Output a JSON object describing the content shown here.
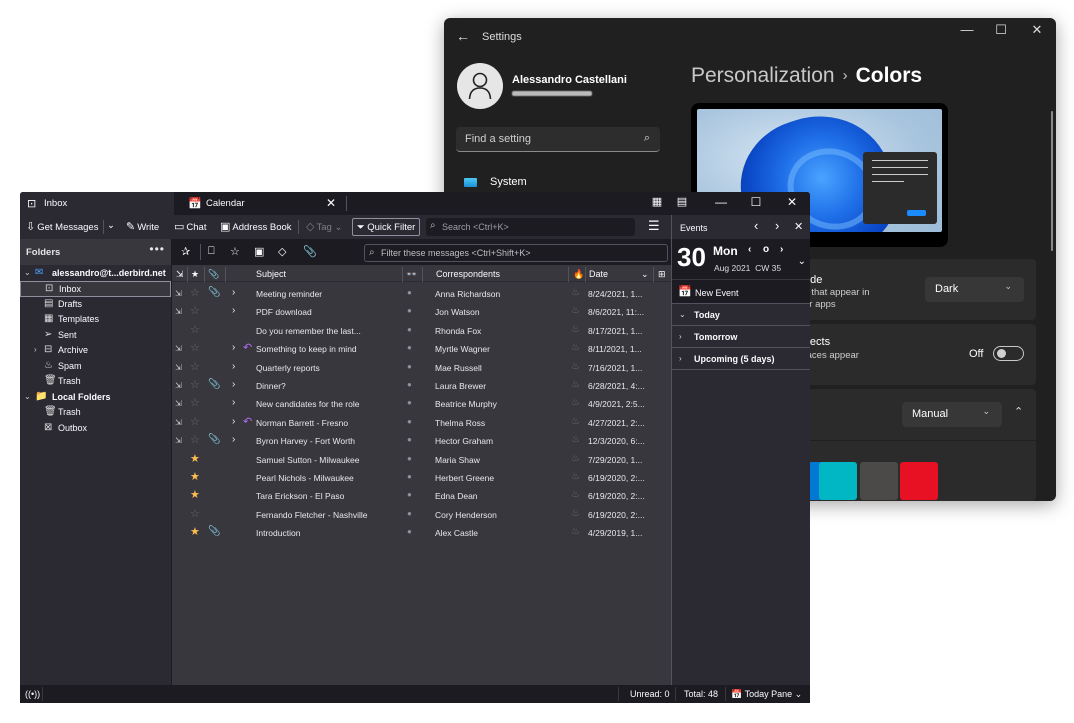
{
  "settings": {
    "title": "Settings",
    "back_icon": "back-arrow-icon",
    "window_controls": {
      "minimize": "—",
      "maximize": "☐",
      "close": "✕"
    },
    "user": {
      "name": "Alessandro Castellani"
    },
    "search": {
      "placeholder": "Find a setting",
      "icon": "⌕"
    },
    "nav": [
      {
        "label": "System",
        "icon": "system-icon"
      }
    ],
    "breadcrumb": {
      "parent": "Personalization",
      "separator": "›",
      "current": "Colors"
    },
    "cards": [
      {
        "title_fragment": "ode",
        "desc_lines": [
          "s that appear in",
          "ur apps"
        ],
        "control": "select",
        "value": "Dark",
        "chevron": "⌄"
      },
      {
        "title_fragment": "ffects",
        "desc_lines": [
          "faces appear"
        ],
        "control": "toggle",
        "value": "Off",
        "state": false
      },
      {
        "control": "select",
        "value": "Manual",
        "chevron": "⌄",
        "expand": "⌃"
      }
    ],
    "accent_swatches": [
      {
        "color": "#0078d4"
      },
      {
        "color": "#00b7c3"
      },
      {
        "color": "#4c4a48"
      },
      {
        "color": "#e81123"
      }
    ]
  },
  "thunderbird": {
    "tabs": [
      {
        "label": "Inbox",
        "icon": "inbox-icon",
        "active": true
      },
      {
        "label": "Calendar",
        "icon": "calendar-icon",
        "active": false,
        "close": "✕"
      }
    ],
    "window_controls": {
      "minimize": "—",
      "maximize": "☐",
      "close": "✕"
    },
    "toolbar": {
      "get_messages": "Get Messages",
      "write": "Write",
      "chat": "Chat",
      "address_book": "Address Book",
      "tag": "Tag",
      "quick_filter": "Quick Filter",
      "search_placeholder": "Search <Ctrl+K>",
      "menu": "☰"
    },
    "folders": {
      "header": "Folders",
      "more": "•••",
      "items": [
        {
          "label": "alessandro@t...derbird.net",
          "icon": "✉",
          "twisty": "⌄",
          "level": 0,
          "bold": true
        },
        {
          "label": "Inbox",
          "icon": "⊡",
          "level": 1,
          "selected": true
        },
        {
          "label": "Drafts",
          "icon": "▤",
          "level": 1
        },
        {
          "label": "Templates",
          "icon": "▦",
          "level": 1
        },
        {
          "label": "Sent",
          "icon": "➢",
          "level": 1
        },
        {
          "label": "Archive",
          "icon": "⊟",
          "twisty": "›",
          "level": 1
        },
        {
          "label": "Spam",
          "icon": "♨",
          "level": 1
        },
        {
          "label": "Trash",
          "icon": "🗑",
          "level": 1
        },
        {
          "label": "Local Folders",
          "icon": "📁",
          "twisty": "⌄",
          "level": 0,
          "bold": true
        },
        {
          "label": "Trash",
          "icon": "🗑",
          "level": 1
        },
        {
          "label": "Outbox",
          "icon": "⊠",
          "level": 1
        }
      ]
    },
    "quick_filter_bar": {
      "buttons": [
        "sticky",
        "unread",
        "starred",
        "contact",
        "tags",
        "attachment"
      ],
      "filter_placeholder": "Filter these messages <Ctrl+Shift+K>"
    },
    "columns": {
      "thread": "⇲",
      "star": "★",
      "attachment": "📎",
      "subject": "Subject",
      "read": "👓",
      "correspondents": "Correspondents",
      "junk": "🔥",
      "date": "Date",
      "sort": "⌄",
      "picker": "⊞"
    },
    "messages": [
      {
        "thread": true,
        "starred": false,
        "attachment": true,
        "twisty": true,
        "replied": false,
        "subject": "Meeting reminder",
        "correspondent": "Anna Richardson",
        "date": "8/24/2021, 1..."
      },
      {
        "thread": true,
        "starred": false,
        "attachment": false,
        "twisty": true,
        "replied": false,
        "subject": "PDF download",
        "correspondent": "Jon Watson",
        "date": "8/6/2021, 11:..."
      },
      {
        "thread": false,
        "starred": false,
        "attachment": false,
        "twisty": false,
        "replied": false,
        "subject": "Do you remember the last...",
        "correspondent": "Rhonda Fox",
        "date": "8/17/2021, 1..."
      },
      {
        "thread": true,
        "starred": false,
        "attachment": false,
        "twisty": true,
        "replied": true,
        "subject": "Something to keep in mind",
        "correspondent": "Myrtle Wagner",
        "date": "8/11/2021, 1..."
      },
      {
        "thread": true,
        "starred": false,
        "attachment": false,
        "twisty": true,
        "replied": false,
        "subject": "Quarterly reports",
        "correspondent": "Mae Russell",
        "date": "7/16/2021, 1..."
      },
      {
        "thread": true,
        "starred": false,
        "attachment": true,
        "twisty": true,
        "replied": false,
        "subject": "Dinner?",
        "correspondent": "Laura Brewer",
        "date": "6/28/2021, 4:..."
      },
      {
        "thread": true,
        "starred": false,
        "attachment": false,
        "twisty": true,
        "replied": false,
        "subject": "New candidates for the role",
        "correspondent": "Beatrice Murphy",
        "date": "4/9/2021, 2:5..."
      },
      {
        "thread": true,
        "starred": false,
        "attachment": false,
        "twisty": true,
        "replied": true,
        "subject": "Norman Barrett - Fresno",
        "correspondent": "Thelma Ross",
        "date": "4/27/2021, 2:..."
      },
      {
        "thread": true,
        "starred": false,
        "attachment": true,
        "twisty": true,
        "replied": false,
        "subject": "Byron Harvey - Fort Worth",
        "correspondent": "Hector Graham",
        "date": "12/3/2020, 6:..."
      },
      {
        "thread": false,
        "starred": true,
        "attachment": false,
        "twisty": false,
        "replied": false,
        "subject": "Samuel Sutton - Milwaukee",
        "correspondent": "Maria Shaw",
        "date": "7/29/2020, 1..."
      },
      {
        "thread": false,
        "starred": true,
        "attachment": false,
        "twisty": false,
        "replied": false,
        "subject": "Pearl Nichols - Milwaukee",
        "correspondent": "Herbert Greene",
        "date": "6/19/2020, 2:..."
      },
      {
        "thread": false,
        "starred": true,
        "attachment": false,
        "twisty": false,
        "replied": false,
        "subject": "Tara Erickson - El Paso",
        "correspondent": "Edna Dean",
        "date": "6/19/2020, 2:..."
      },
      {
        "thread": false,
        "starred": false,
        "attachment": false,
        "twisty": false,
        "replied": false,
        "subject": "Fernando Fletcher - Nashville",
        "correspondent": "Cory Henderson",
        "date": "6/19/2020, 2:..."
      },
      {
        "thread": false,
        "starred": true,
        "attachment": true,
        "twisty": false,
        "replied": false,
        "subject": "Introduction",
        "correspondent": "Alex Castle",
        "date": "4/29/2019, 1..."
      }
    ],
    "today_pane": {
      "header": "Events",
      "day_number": "30",
      "weekday": "Mon",
      "month_year": "Aug 2021",
      "calendar_week": "CW 35",
      "new_event": "New Event",
      "sections": [
        {
          "label": "Today",
          "expanded": true
        },
        {
          "label": "Tomorrow",
          "expanded": false
        },
        {
          "label": "Upcoming (5 days)",
          "expanded": false
        }
      ]
    },
    "status_bar": {
      "unread": "Unread: 0",
      "total": "Total: 48",
      "today_pane_label": "Today Pane"
    }
  }
}
